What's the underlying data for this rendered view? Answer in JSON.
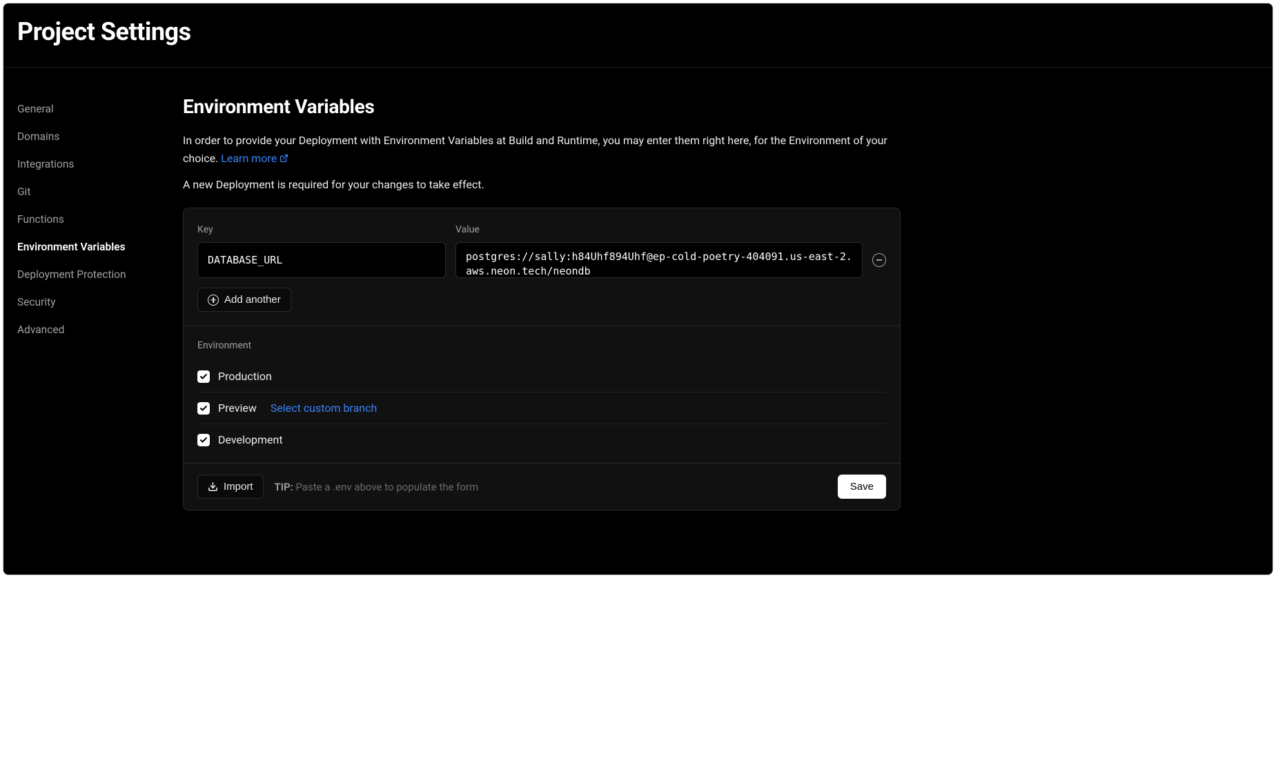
{
  "header": {
    "title": "Project Settings"
  },
  "sidebar": {
    "items": [
      {
        "label": "General"
      },
      {
        "label": "Domains"
      },
      {
        "label": "Integrations"
      },
      {
        "label": "Git"
      },
      {
        "label": "Functions"
      },
      {
        "label": "Environment Variables"
      },
      {
        "label": "Deployment Protection"
      },
      {
        "label": "Security"
      },
      {
        "label": "Advanced"
      }
    ]
  },
  "main": {
    "heading": "Environment Variables",
    "description_pre": "In order to provide your Deployment with Environment Variables at Build and Runtime, you may enter them right here, for the Environment of your choice. ",
    "learn_more": "Learn more",
    "sub_note": "A new Deployment is required for your changes to take effect.",
    "key_label": "Key",
    "value_label": "Value",
    "row": {
      "key": "DATABASE_URL",
      "value": "postgres://sally:h84Uhf894Uhf@ep-cold-poetry-404091.us-east-2.aws.neon.tech/neondb"
    },
    "add_another": "Add another",
    "env_section_label": "Environment",
    "environments": [
      {
        "name": "Production",
        "branch_link": null
      },
      {
        "name": "Preview",
        "branch_link": "Select custom branch"
      },
      {
        "name": "Development",
        "branch_link": null
      }
    ],
    "import_label": "Import",
    "tip_label": "TIP:",
    "tip_text": " Paste a .env above to populate the form",
    "save_label": "Save"
  }
}
